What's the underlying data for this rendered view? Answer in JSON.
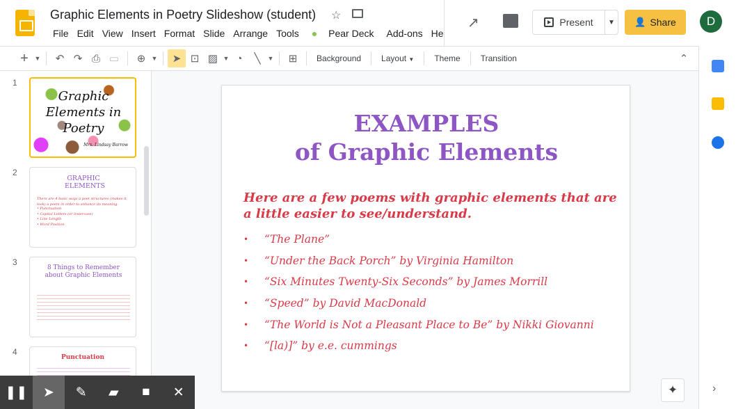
{
  "app": {
    "doc_title": "Graphic Elements in Poetry Slideshow (student)",
    "menu": [
      "File",
      "Edit",
      "View",
      "Insert",
      "Format",
      "Slide",
      "Arrange",
      "Tools",
      "Pear Deck",
      "Add-ons",
      "He"
    ]
  },
  "header": {
    "present_label": "Present",
    "share_label": "Share",
    "avatar_letter": "D"
  },
  "toolbar": {
    "background_label": "Background",
    "layout_label": "Layout",
    "theme_label": "Theme",
    "transition_label": "Transition"
  },
  "filmstrip": {
    "slides": [
      {
        "number": "1",
        "title": "Graphic Elements in Poetry",
        "author": "Mrs. Lindsay Barrow"
      },
      {
        "number": "2",
        "title": "GRAPHIC ELEMENTS",
        "intro": "There are 4 basic ways a poet structures (makes it look) a poem in order to enhance its meaning.",
        "items": [
          "Punctuation",
          "Capital Letters (or lowercase)",
          "Line Length",
          "Word Position"
        ]
      },
      {
        "number": "3",
        "title": "8 Things to Remember about Graphic Elements"
      },
      {
        "number": "4",
        "title": "Punctuation"
      }
    ]
  },
  "slide": {
    "title_line1": "EXAMPLES",
    "title_line2": "of Graphic Elements",
    "intro": "Here are a few poems with graphic elements that are a little easier to see/understand.",
    "items": [
      "“The Plane”",
      "“Under the Back Porch” by Virginia Hamilton",
      "“Six Minutes Twenty-Six Seconds” by James Morrill",
      "“Speed” by David MacDonald",
      "“The World is Not a Pleasant Place to Be” by Nikki Giovanni",
      "“[la)]” by e.e. cummings"
    ]
  },
  "colors": {
    "title_purple": "#8e55c4",
    "body_red": "#d93a48",
    "share_yellow": "#f6c143",
    "avatar_green": "#1e6b3d"
  }
}
